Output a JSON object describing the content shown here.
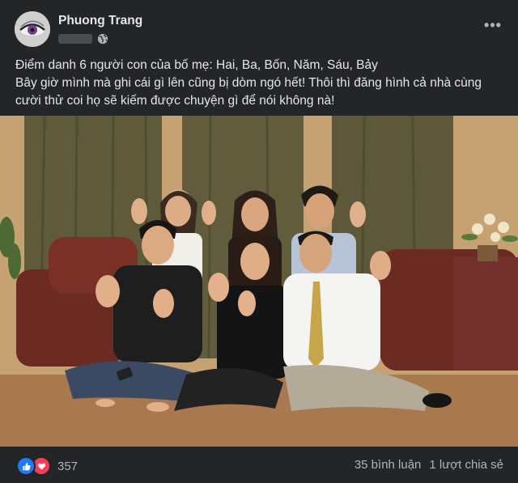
{
  "post": {
    "author": "Phuong Trang",
    "more_label": "•••",
    "caption_line1": "Điểm danh 6 người con của bố mẹ: Hai, Ba, Bốn, Năm, Sáu, Bảy",
    "caption_line2": "Bây giờ mình mà ghi cái gì lên cũng bị dòm ngó hết! Thôi thì đăng hình cả nhà cùng",
    "caption_line3": "cười thử coi họ sẽ kiếm được chuyện gì để nói không nà!"
  },
  "footer": {
    "reaction_icons": [
      "like-icon",
      "love-icon"
    ],
    "reaction_count": "357",
    "comments": "35 bình luận",
    "shares": "1 lượt chia sẻ"
  },
  "colors": {
    "background": "#242526",
    "text_primary": "#e4e6eb",
    "text_secondary": "#b0b3b8",
    "like_blue": "#2078f4",
    "love_red": "#f33e58"
  }
}
